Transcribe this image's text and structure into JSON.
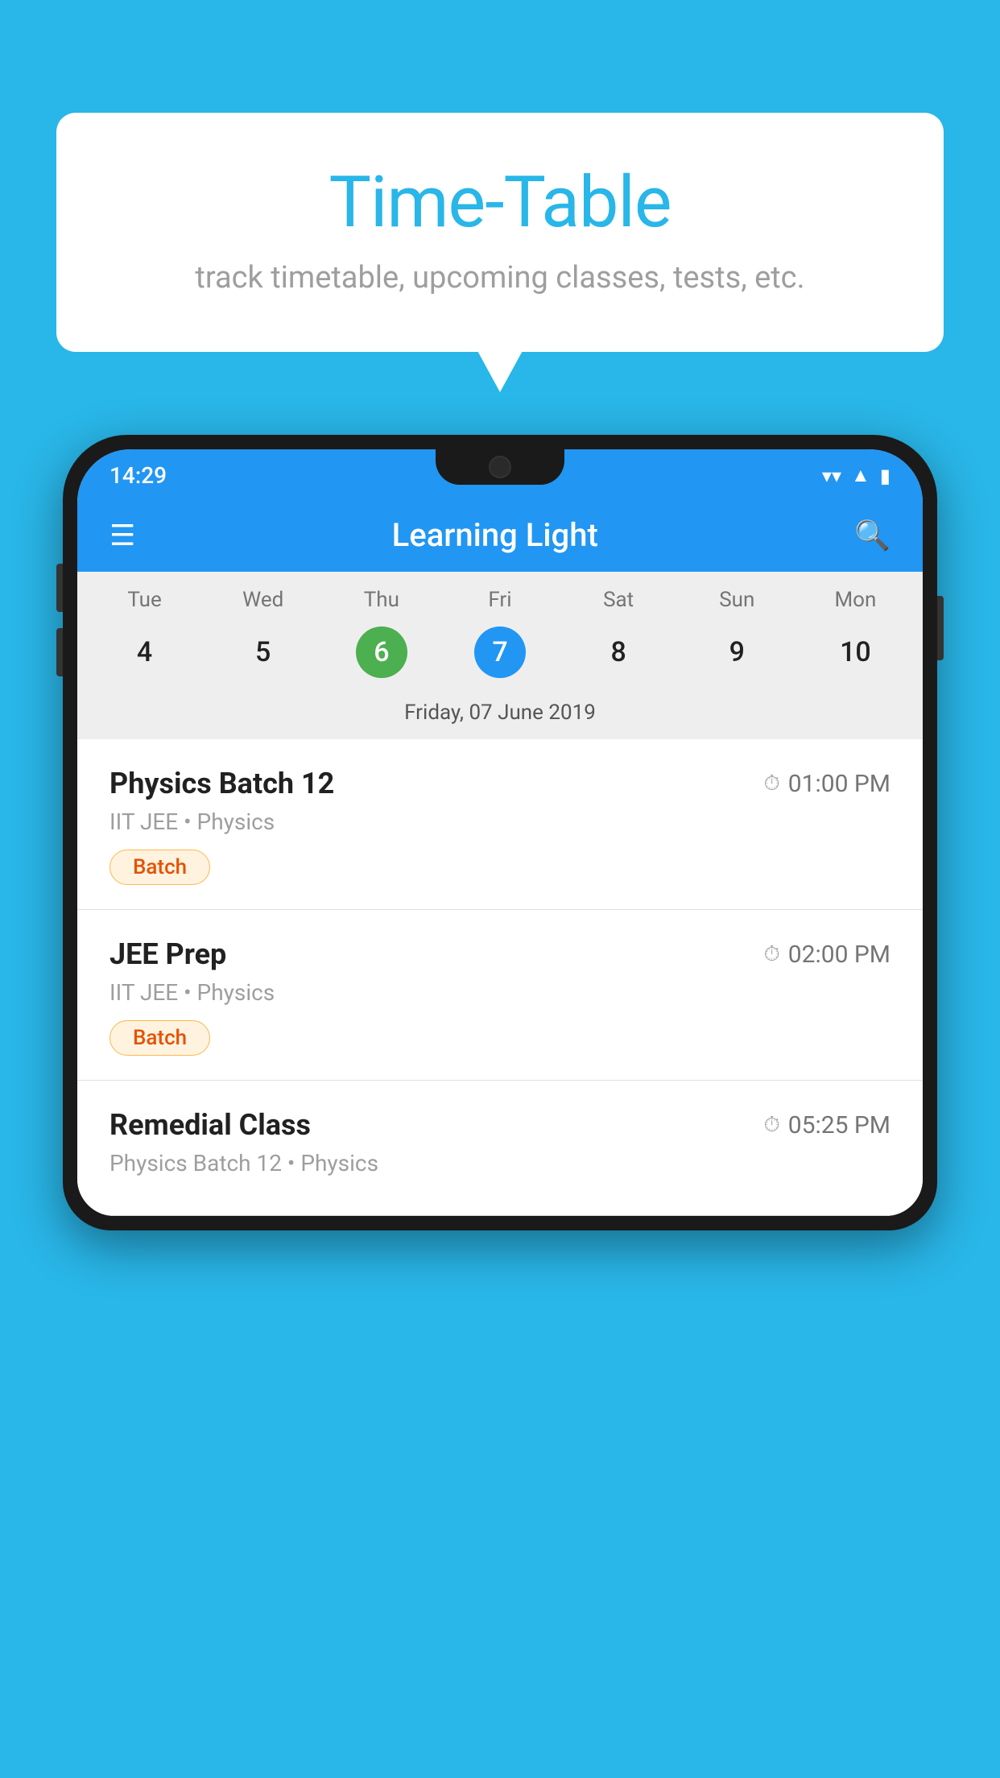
{
  "background_color": "#29B6E8",
  "speech_bubble": {
    "title": "Time-Table",
    "subtitle": "track timetable, upcoming classes, tests, etc."
  },
  "phone": {
    "status_bar": {
      "time": "14:29",
      "wifi": "▼",
      "signal": "▲",
      "battery": "▮"
    },
    "header": {
      "app_name": "Learning Light",
      "menu_icon": "☰",
      "search_icon": "🔍"
    },
    "calendar": {
      "days_of_week": [
        "Tue",
        "Wed",
        "Thu",
        "Fri",
        "Sat",
        "Sun",
        "Mon"
      ],
      "day_numbers": [
        "4",
        "5",
        "6",
        "7",
        "8",
        "9",
        "10"
      ],
      "today_index": 2,
      "selected_index": 3,
      "selected_date_label": "Friday, 07 June 2019"
    },
    "schedule": [
      {
        "title": "Physics Batch 12",
        "time": "01:00 PM",
        "subtitle": "IIT JEE • Physics",
        "badge": "Batch"
      },
      {
        "title": "JEE Prep",
        "time": "02:00 PM",
        "subtitle": "IIT JEE • Physics",
        "badge": "Batch"
      },
      {
        "title": "Remedial Class",
        "time": "05:25 PM",
        "subtitle": "Physics Batch 12 • Physics",
        "badge": ""
      }
    ]
  }
}
